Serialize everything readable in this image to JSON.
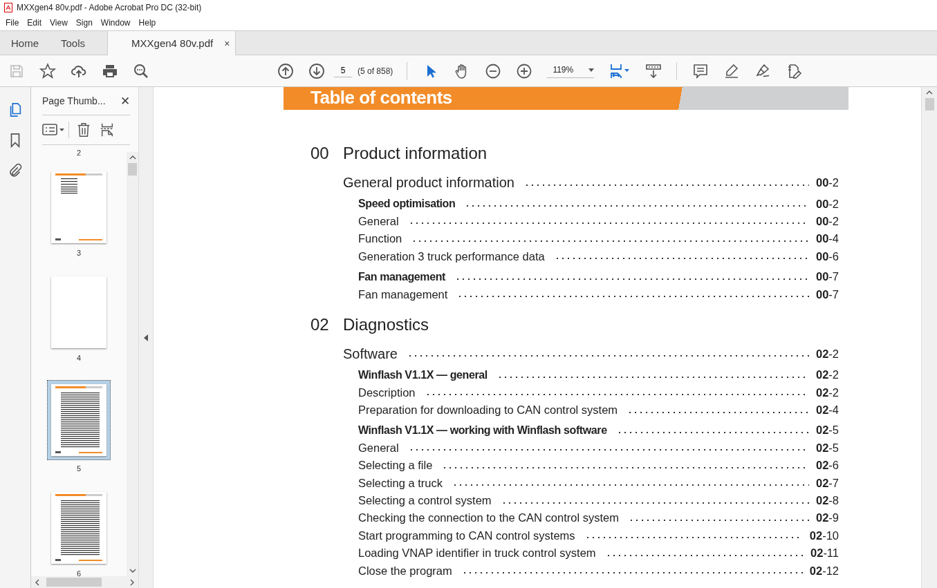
{
  "window": {
    "title": "MXXgen4 80v.pdf - Adobe Acrobat Pro DC (32-bit)"
  },
  "menu": [
    "File",
    "Edit",
    "View",
    "Sign",
    "Window",
    "Help"
  ],
  "tabs": [
    {
      "label": "Home",
      "selected": false
    },
    {
      "label": "Tools",
      "selected": false
    },
    {
      "label": "MXXgen4 80v.pdf",
      "selected": true,
      "close": "×"
    }
  ],
  "toolbar": {
    "page_value": "5",
    "page_count": "(5 of 858)",
    "zoom": "119%"
  },
  "side_panel": {
    "title": "Page Thumb...",
    "close": "✕",
    "top_label": "2",
    "thumbnails": [
      {
        "label": "3",
        "kind": "sparse",
        "selected": false
      },
      {
        "label": "4",
        "kind": "blank",
        "selected": false
      },
      {
        "label": "5",
        "kind": "dense",
        "selected": true
      },
      {
        "label": "6",
        "kind": "dense",
        "selected": false
      }
    ]
  },
  "document": {
    "header": "Table of contents",
    "sections": [
      {
        "number": "00",
        "title": "Product information",
        "entries": [
          {
            "kind": "heading",
            "text": "General product information",
            "page": "**00**-2"
          },
          {
            "kind": "subheading",
            "text": "Speed optimisation",
            "page": "**00**-2"
          },
          {
            "kind": "item",
            "text": "General",
            "page": "**00**-2"
          },
          {
            "kind": "item",
            "text": "Function",
            "page": "**00**-4"
          },
          {
            "kind": "item",
            "text": "Generation 3 truck performance data",
            "page": "**00**-6"
          },
          {
            "kind": "subheading",
            "text": "Fan management",
            "page": "**00**-7"
          },
          {
            "kind": "item",
            "text": "Fan management",
            "page": "**00**-7"
          }
        ]
      },
      {
        "number": "02",
        "title": "Diagnostics",
        "entries": [
          {
            "kind": "heading",
            "text": "Software",
            "page": "**02**-2"
          },
          {
            "kind": "subheading",
            "text": "Winflash V1.1X — general",
            "page": "**02**-2"
          },
          {
            "kind": "item",
            "text": "Description",
            "page": "**02**-2"
          },
          {
            "kind": "item",
            "text": "Preparation for downloading to CAN control system",
            "page": "**02**-4"
          },
          {
            "kind": "subheading",
            "text": "Winflash V1.1X — working with Winflash software",
            "page": "**02**-5"
          },
          {
            "kind": "item",
            "text": "General",
            "page": "**02**-5"
          },
          {
            "kind": "item",
            "text": "Selecting a file",
            "page": "**02**-6"
          },
          {
            "kind": "item",
            "text": "Selecting a truck",
            "page": "**02**-7"
          },
          {
            "kind": "item",
            "text": "Selecting a control system",
            "page": "**02**-8"
          },
          {
            "kind": "item",
            "text": "Checking the connection to the CAN control system",
            "page": "**02**-9"
          },
          {
            "kind": "item",
            "text": "Start programming to CAN control systems",
            "page": "**02**-10"
          },
          {
            "kind": "item",
            "text": "Loading VNAP identifier in truck control system",
            "page": "**02**-11"
          },
          {
            "kind": "item",
            "text": "Close the program",
            "page": "**02**-12"
          }
        ]
      }
    ]
  }
}
